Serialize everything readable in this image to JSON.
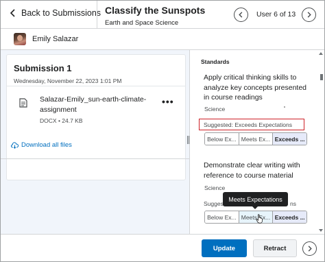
{
  "header": {
    "back_label": "Back to Submissions",
    "title": "Classify the Sunspots",
    "subtitle": "Earth and Space Science",
    "user_position": "User 6 of 13"
  },
  "user": {
    "name": "Emily Salazar"
  },
  "submission": {
    "title": "Submission 1",
    "date": "Wednesday, November 22, 2023 1:01 PM",
    "file_name": "Salazar-Emily_sun-earth-climate-assignment",
    "file_type": "DOCX",
    "file_size": "24.7 KB",
    "more_icon": "•••",
    "download_label": "Download all files"
  },
  "standards": {
    "heading": "Standards",
    "items": [
      {
        "text": "Apply critical thinking skills to analyze key concepts presented in course readings",
        "category": "Science",
        "suggested": "Suggested: Exceeds Expectations",
        "levels": [
          "Below Ex...",
          "Meets Ex...",
          "Exceeds ..."
        ],
        "selected": "Exceeds ..."
      },
      {
        "text": "Demonstrate clear writing with reference to course material",
        "category": "Science",
        "suggested": "Sugges",
        "suggested_tail": "ns",
        "levels": [
          "Below Ex...",
          "Meets Ex...",
          "Exceeds ..."
        ],
        "selected": "Exceeds ..."
      }
    ],
    "tooltip": "Meets Expectations"
  },
  "footer": {
    "update_label": "Update",
    "retract_label": "Retract"
  },
  "colors": {
    "primary": "#006fbf",
    "highlight_border": "#cd2026",
    "selected_level_bg": "#e6eaf9"
  }
}
